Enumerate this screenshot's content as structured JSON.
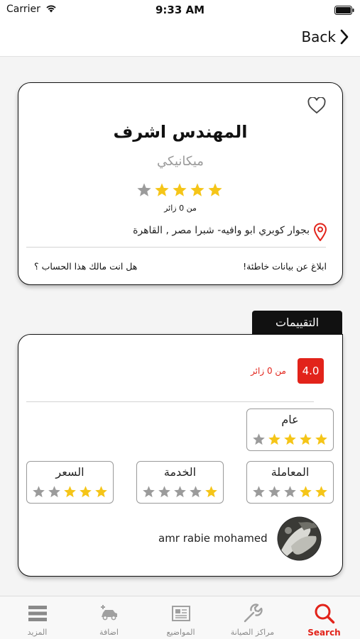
{
  "status_bar": {
    "carrier": "Carrier",
    "time": "9:33 AM"
  },
  "nav": {
    "back_label": "Back"
  },
  "profile": {
    "name": "المهندس اشرف",
    "specialty": "ميكانيكي",
    "rating_stars": 4,
    "max_stars": 5,
    "visitors": "من 0 زائر",
    "address": "بجوار كوبري ابو وافيه- شبرا مصر , القاهرة",
    "report_link": "ابلاغ عن بيانات خاطئة!",
    "owner_link": "هل انت مالك هذا الحساب ؟"
  },
  "reviews": {
    "tab_label": "التقييمات",
    "score": "4.0",
    "visitors": "من 0 زائر",
    "categories": [
      {
        "label": "عام",
        "stars": 4
      },
      {
        "label": "المعاملة",
        "stars": 2
      },
      {
        "label": "الخدمة",
        "stars": 1
      },
      {
        "label": "السعر",
        "stars": 3
      }
    ],
    "reviewer": {
      "name": "amr rabie mohamed"
    }
  },
  "tabbar": {
    "items": [
      {
        "label": "Search",
        "icon": "search-icon",
        "active": true
      },
      {
        "label": "مراكز الصيانة",
        "icon": "wrench-icon",
        "active": false
      },
      {
        "label": "المواضيع",
        "icon": "newspaper-icon",
        "active": false
      },
      {
        "label": "اضافة",
        "icon": "car-add-icon",
        "active": false
      },
      {
        "label": "المزيد",
        "icon": "menu-icon",
        "active": false
      }
    ]
  },
  "colors": {
    "accent": "#e2231a",
    "star": "#f5c518",
    "star_empty": "#9b9b9b"
  }
}
